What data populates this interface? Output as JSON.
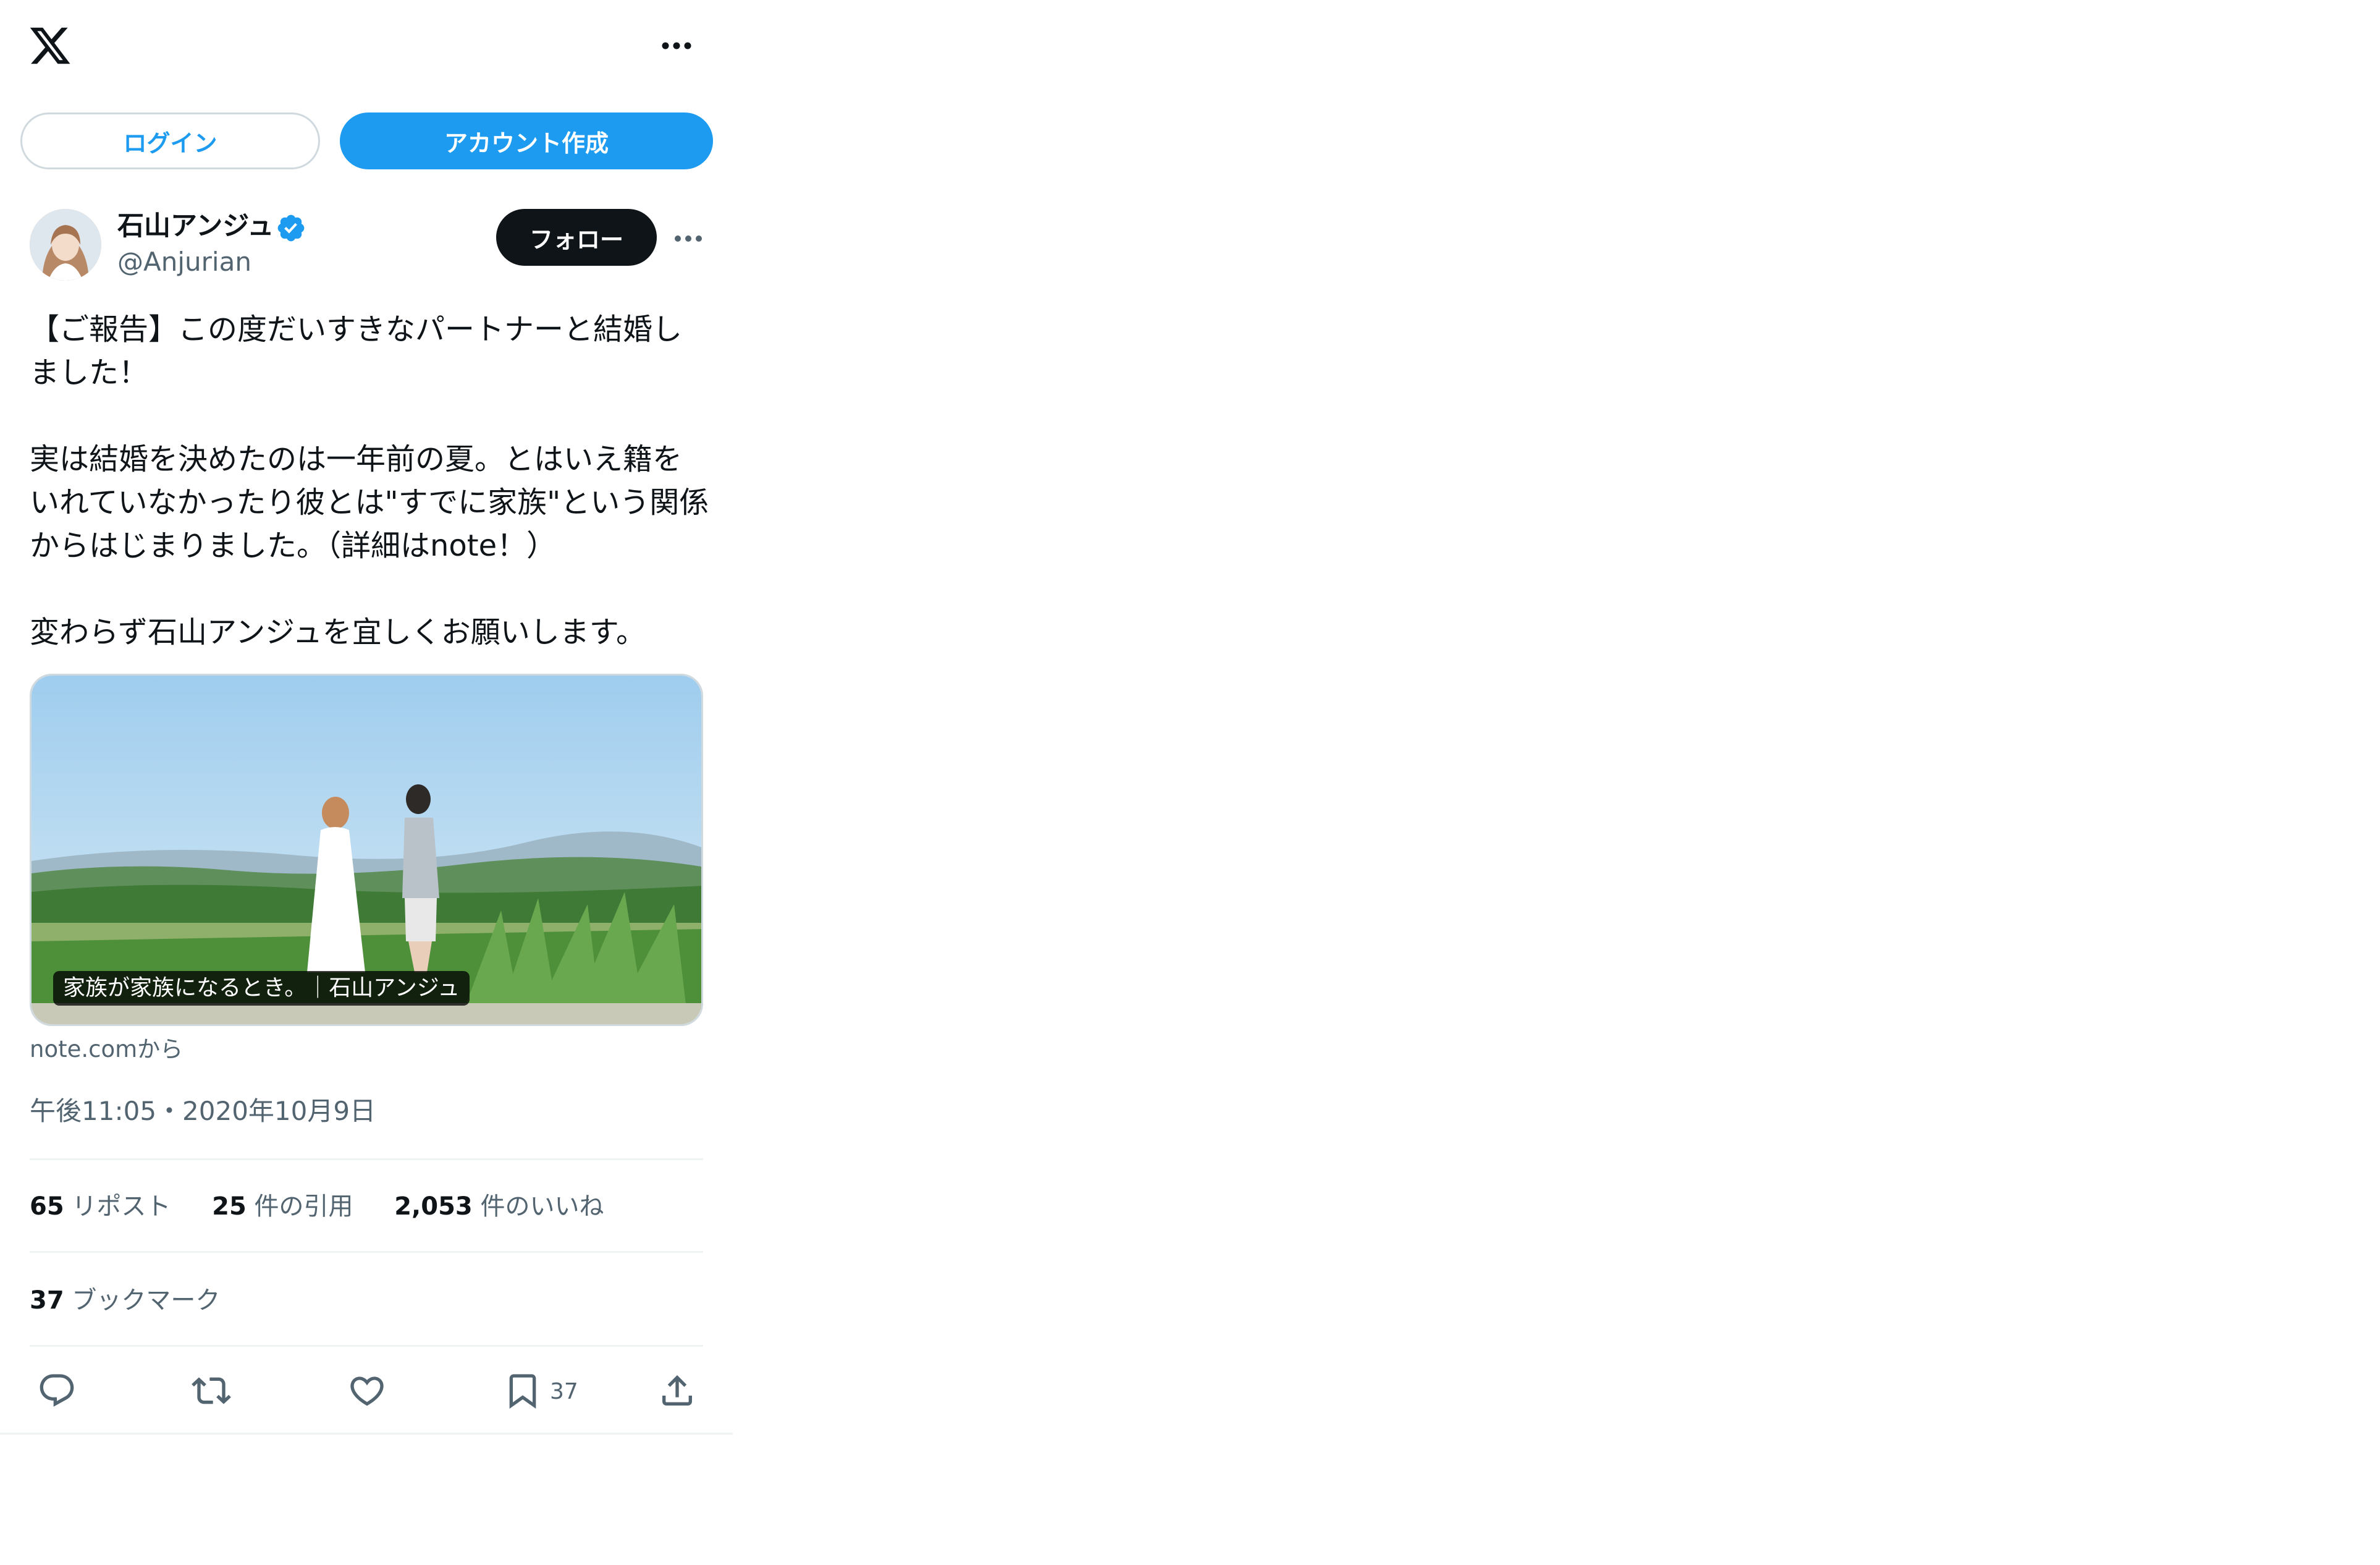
{
  "header": {
    "logo_icon": "x-logo-icon",
    "more_icon": "more-horizontal-icon"
  },
  "auth": {
    "login_label": "ログイン",
    "signup_label": "アカウント作成"
  },
  "tweet": {
    "author_name": "石山アンジュ",
    "handle": "@Anjurian",
    "verified_icon": "verified-badge-icon",
    "follow_label": "フォロー",
    "text": "【ご報告】この度だいすきなパートナーと結婚しました！\n\n実は結婚を決めたのは一年前の夏。とはいえ籍をいれていなかったり彼とは\"すでに家族\"という関係からはじまりました。（詳細はnote！）\n\n変わらず石山アンジュを宜しくお願いします。",
    "card": {
      "caption": "家族が家族になるとき。｜石山アンジュ",
      "source": "note.comから"
    },
    "timestamp": "午後11:05・2020年10月9日",
    "stats": {
      "reposts_value": "65",
      "reposts_label": "リポスト",
      "quotes_value": "25",
      "quotes_label": "件の引用",
      "likes_value": "2,053",
      "likes_label": "件のいいね",
      "bookmarks_value": "37",
      "bookmarks_label": "ブックマーク"
    },
    "actions": {
      "reply_icon": "reply-icon",
      "repost_icon": "repost-icon",
      "like_icon": "heart-icon",
      "bookmark_icon": "bookmark-icon",
      "bookmark_count": "37",
      "share_icon": "share-icon"
    }
  },
  "colors": {
    "accent": "#1d9bf0",
    "text": "#0f1419",
    "muted": "#536471",
    "border": "#cfd9de",
    "divider": "#eff3f4"
  }
}
